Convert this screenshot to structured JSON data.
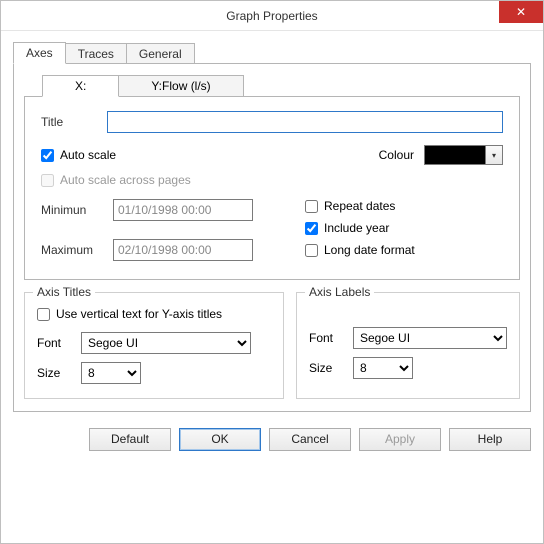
{
  "window": {
    "title": "Graph Properties"
  },
  "tabs": {
    "axes": "Axes",
    "traces": "Traces",
    "general": "General"
  },
  "axistabs": {
    "x": "X:",
    "y": "Y:Flow (l/s)"
  },
  "axis": {
    "titleLabel": "Title",
    "titleValue": "",
    "autoscale": "Auto scale",
    "autoscale_checked": true,
    "autoscale_pages": "Auto scale across pages",
    "autoscale_pages_checked": false,
    "colourLabel": "Colour",
    "colourValue": "#000000",
    "minLabel": "Minimun",
    "minValue": "01/10/1998 00:00",
    "maxLabel": "Maximum",
    "maxValue": "02/10/1998 00:00",
    "repeat": "Repeat dates",
    "repeat_checked": false,
    "includeYear": "Include year",
    "includeYear_checked": true,
    "longDate": "Long date format",
    "longDate_checked": false
  },
  "axisTitles": {
    "legend": "Axis Titles",
    "vertical": "Use vertical text for Y-axis titles",
    "vertical_checked": false,
    "fontLabel": "Font",
    "fontValue": "Segoe UI",
    "sizeLabel": "Size",
    "sizeValue": "8"
  },
  "axisLabels": {
    "legend": "Axis Labels",
    "fontLabel": "Font",
    "fontValue": "Segoe UI",
    "sizeLabel": "Size",
    "sizeValue": "8"
  },
  "buttons": {
    "default": "Default",
    "ok": "OK",
    "cancel": "Cancel",
    "apply": "Apply",
    "help": "Help"
  }
}
